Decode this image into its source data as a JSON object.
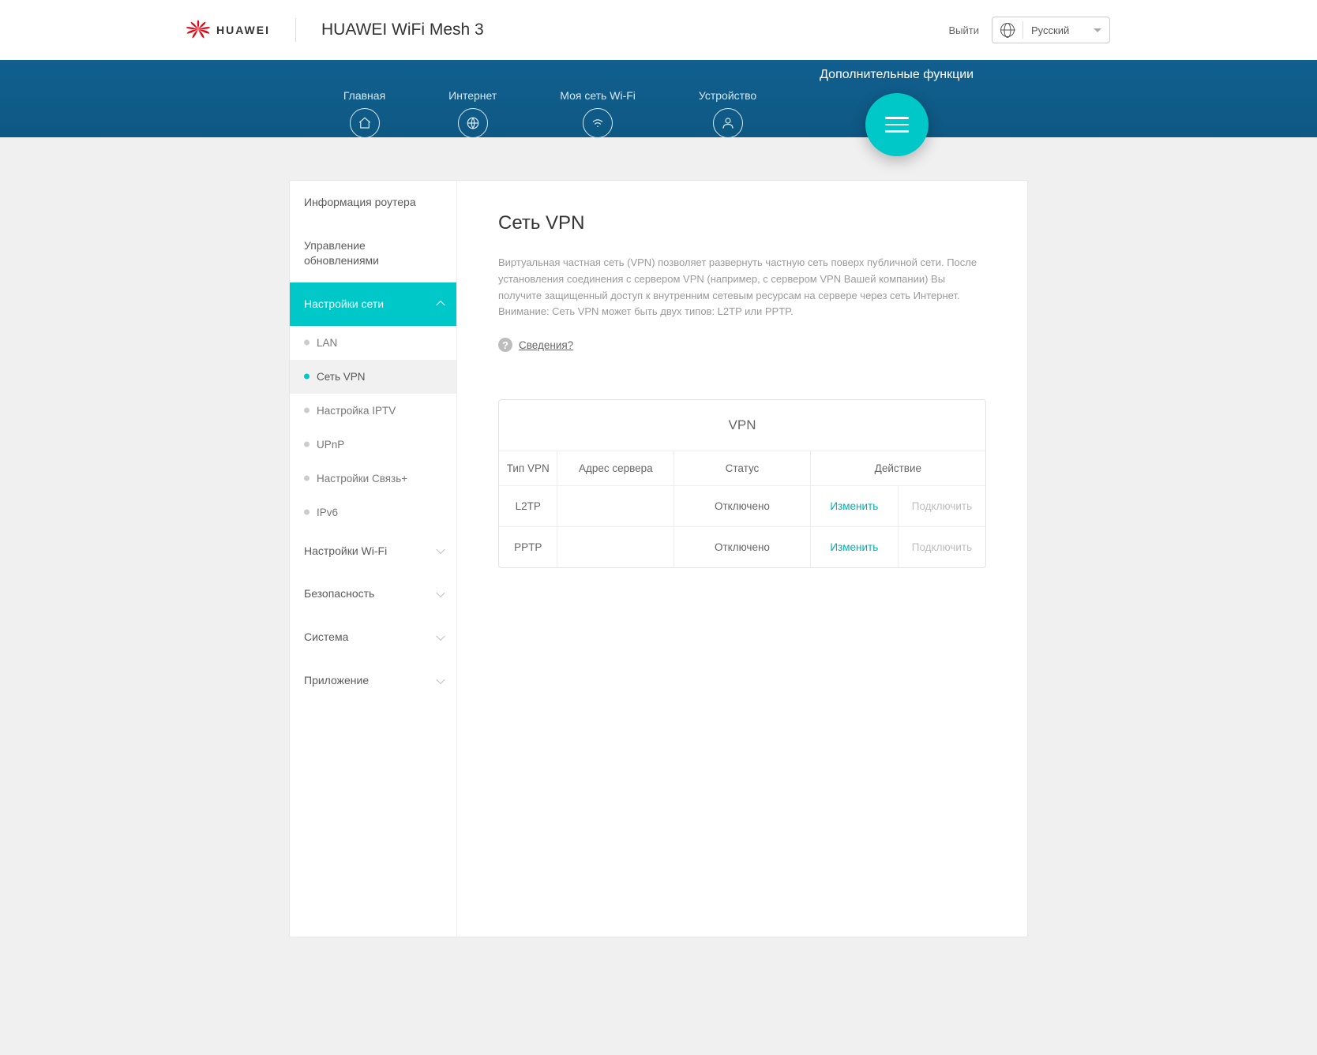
{
  "header": {
    "brand": "HUAWEI",
    "product": "HUAWEI WiFi Mesh 3",
    "logout": "Выйти",
    "language": "Русский"
  },
  "nav": {
    "items": [
      {
        "label": "Главная"
      },
      {
        "label": "Интернет"
      },
      {
        "label": "Моя сеть Wi-Fi"
      },
      {
        "label": "Устройство"
      }
    ],
    "extra_label": "Дополнительные функции"
  },
  "sidebar": {
    "router_info": "Информация роутера",
    "update_mgmt": "Управление обновлениями",
    "network_settings": "Настройки сети",
    "sub": {
      "lan": "LAN",
      "vpn": "Сеть VPN",
      "iptv": "Настройка IPTV",
      "upnp": "UPnP",
      "linkplus": "Настройки Связь+",
      "ipv6": "IPv6"
    },
    "wifi": "Настройки Wi-Fi",
    "security": "Безопасность",
    "system": "Система",
    "app": "Приложение"
  },
  "content": {
    "title": "Сеть VPN",
    "description": "Виртуальная частная сеть (VPN) позволяет развернуть частную сеть поверх публичной сети. После установления соединения с сервером VPN (например, с сервером VPN Вашей компании) Вы получите защищенный доступ к внутренним сетевым ресурсам на сервере через сеть Интернет. Внимание: Сеть VPN может быть двух типов: L2TP или PPTP.",
    "help": "Сведения?",
    "table_title": "VPN",
    "columns": {
      "type": "Тип VPN",
      "server": "Адрес сервера",
      "status": "Статус",
      "action": "Действие"
    },
    "rows": [
      {
        "type": "L2TP",
        "server": "",
        "status": "Отключено",
        "edit": "Изменить",
        "connect": "Подключить"
      },
      {
        "type": "PPTP",
        "server": "",
        "status": "Отключено",
        "edit": "Изменить",
        "connect": "Подключить"
      }
    ]
  }
}
